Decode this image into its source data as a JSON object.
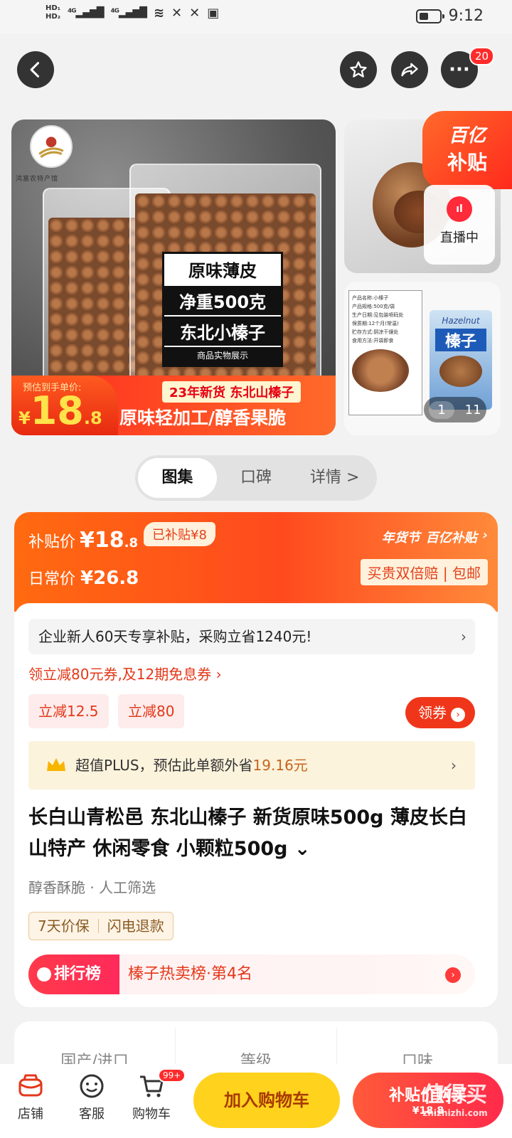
{
  "status": {
    "time": "9:12",
    "network": "4G"
  },
  "nav": {
    "notification_count": "20"
  },
  "gallery": {
    "main": {
      "logo_caption": "鸿富农特产馆",
      "label_line1": "原味薄皮",
      "label_line2": "净重500克",
      "label_line3": "东北小榛子",
      "label_line4": "商品实物展示",
      "estimate_label": "预估到手单价:",
      "estimate_price_int": "18",
      "estimate_price_dec": ".8",
      "currency": "¥",
      "ribbon_top": "23年新货 东北山榛子",
      "ribbon_bottom": "原味轻加工/醇香果脆"
    },
    "subsidy_tag_top": "百亿",
    "subsidy_tag_bottom": "补贴",
    "live_label": "直播中",
    "spec_card": {
      "name": "产品名称:小榛子",
      "spec": "产品规格:500克/袋",
      "date": "生产日期:见包装喷码处",
      "shelf": "保质期:12个月(常温)",
      "storage": "贮存方式:阴凉干燥处",
      "usage": "食用方法:开袋即食"
    },
    "package": {
      "hazelnut": "Hazelnut",
      "name": "榛子"
    },
    "pager_current": "1",
    "pager_total": "11"
  },
  "tabs": [
    {
      "label": "图集",
      "active": true
    },
    {
      "label": "口碑",
      "active": false
    },
    {
      "label": "详情 >",
      "active": false
    }
  ],
  "price": {
    "subsidy_label": "补贴价",
    "subsidy_price": "¥18",
    "subsidy_price_dec": ".8",
    "already_subsidized": "已补贴¥8",
    "daily_label": "日常价",
    "daily_price": "¥26.8",
    "brand_tag1": "年货节",
    "brand_tag2": "百亿补贴",
    "double_compensation": "买贵双倍赔 | 包邮"
  },
  "promo": {
    "enterprise": "企业新人60天专享补贴，采购立省1240元!",
    "coupon_line": "领立减80元券,及12期免息券 ›",
    "chip1": "立减12.5",
    "chip2": "立减80",
    "get_coupon": "领券",
    "plus_text": "超值PLUS，预估此单额外省",
    "plus_save": "19.16元"
  },
  "product": {
    "title": "长白山青松邑 东北山榛子 新货原味500g 薄皮长白山特产 休闲零食 小颗粒500g ⌄",
    "tags": "醇香酥脆 · 人工筛选",
    "guarantee1": "7天价保",
    "guarantee2": "闪电退款",
    "rank_tag": "排行榜",
    "rank_text": "榛子热卖榜·第4名"
  },
  "attributes": [
    {
      "label": "国产/进口"
    },
    {
      "label": "等级"
    },
    {
      "label": "口味"
    }
  ],
  "bottom": {
    "store": "店铺",
    "service": "客服",
    "cart": "购物车",
    "cart_badge": "99+",
    "add_to_cart": "加入购物车",
    "buy": "补贴价购买",
    "buy_price": "¥18.8",
    "watermark": "值得买",
    "watermark_sub": "zhizhizhi.com"
  },
  "colors": {
    "accent": "#ff4a1e",
    "cart_yellow": "#ffd21e",
    "price_red": "#e4381a"
  }
}
